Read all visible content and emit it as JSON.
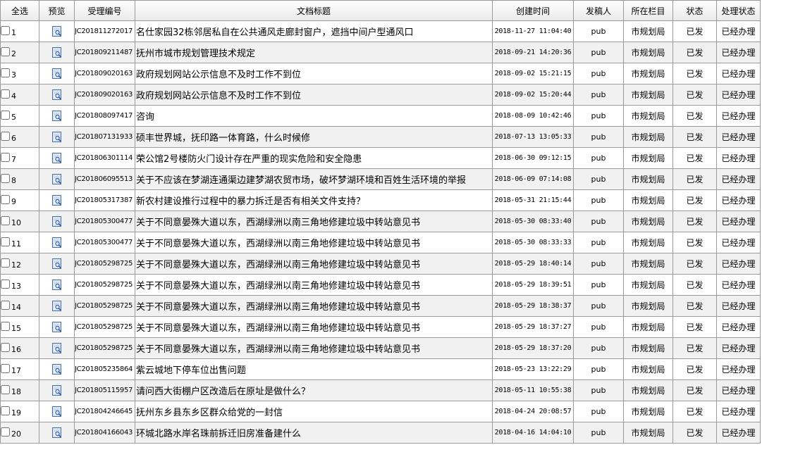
{
  "headers": {
    "select_all": "全选",
    "preview": "预览",
    "number": "受理编号",
    "title": "文档标题",
    "created": "创建时间",
    "sender": "发稿人",
    "column": "所在栏目",
    "status": "状态",
    "process": "处理状态"
  },
  "colors": {
    "border": "#9a9a9a",
    "row_alt": "#f1f1f1"
  },
  "icons": {
    "preview": "document-preview-icon"
  },
  "rows": [
    {
      "idx": "1",
      "no": "JC201811272017",
      "title": "名仕家园32栋邻居私自在公共通风走廊封窗户，遮挡中间户型通风口",
      "time": "2018-11-27 11:04:40",
      "sender": "pub",
      "column": "市规划局",
      "status": "已发",
      "process": "已经办理"
    },
    {
      "idx": "2",
      "no": "JC201809211487",
      "title": "抚州市城市规划管理技术规定",
      "time": "2018-09-21 14:20:36",
      "sender": "pub",
      "column": "市规划局",
      "status": "已发",
      "process": "已经办理"
    },
    {
      "idx": "3",
      "no": "JC201809020163",
      "title": "政府规划网站公示信息不及时工作不到位",
      "time": "2018-09-02 15:21:15",
      "sender": "pub",
      "column": "市规划局",
      "status": "已发",
      "process": "已经办理"
    },
    {
      "idx": "4",
      "no": "JC201809020163",
      "title": "政府规划网站公示信息不及时工作不到位",
      "time": "2018-09-02 15:20:44",
      "sender": "pub",
      "column": "市规划局",
      "status": "已发",
      "process": "已经办理"
    },
    {
      "idx": "5",
      "no": "JC201808097417",
      "title": "咨询",
      "time": "2018-08-09 10:42:46",
      "sender": "pub",
      "column": "市规划局",
      "status": "已发",
      "process": "已经办理"
    },
    {
      "idx": "6",
      "no": "JC201807131933",
      "title": "硕丰世界城，抚印路一体育路，什么时候修",
      "time": "2018-07-13 13:05:33",
      "sender": "pub",
      "column": "市规划局",
      "status": "已发",
      "process": "已经办理"
    },
    {
      "idx": "7",
      "no": "JC201806301114",
      "title": "荣公馆2号楼防火门设计存在严重的现实危险和安全隐患",
      "time": "2018-06-30 09:12:15",
      "sender": "pub",
      "column": "市规划局",
      "status": "已发",
      "process": "已经办理"
    },
    {
      "idx": "8",
      "no": "JC201806095513",
      "title": "关于不应该在梦湖连通渠边建梦湖农贸市场，破坏梦湖环境和百姓生活环境的举报",
      "time": "2018-06-09 07:14:08",
      "sender": "pub",
      "column": "市规划局",
      "status": "已发",
      "process": "已经办理"
    },
    {
      "idx": "9",
      "no": "JC201805317387",
      "title": "新农村建设推行过程中的暴力拆迁是否有相关文件支持？",
      "time": "2018-05-31 21:15:44",
      "sender": "pub",
      "column": "市规划局",
      "status": "已发",
      "process": "已经办理"
    },
    {
      "idx": "10",
      "no": "JC201805300477",
      "title": "关于不同意晏殊大道以东，西湖绿洲以南三角地修建垃圾中转站意见书",
      "time": "2018-05-30 08:33:40",
      "sender": "pub",
      "column": "市规划局",
      "status": "已发",
      "process": "已经办理"
    },
    {
      "idx": "11",
      "no": "JC201805300477",
      "title": "关于不同意晏殊大道以东，西湖绿洲以南三角地修建垃圾中转站意见书",
      "time": "2018-05-30 08:33:33",
      "sender": "pub",
      "column": "市规划局",
      "status": "已发",
      "process": "已经办理"
    },
    {
      "idx": "12",
      "no": "JC201805298725",
      "title": "关于不同意晏殊大道以东，西湖绿洲以南三角地修建垃圾中转站意见书",
      "time": "2018-05-29 18:40:14",
      "sender": "pub",
      "column": "市规划局",
      "status": "已发",
      "process": "已经办理"
    },
    {
      "idx": "13",
      "no": "JC201805298725",
      "title": "关于不同意晏殊大道以东，西湖绿洲以南三角地修建垃圾中转站意见书",
      "time": "2018-05-29 18:39:51",
      "sender": "pub",
      "column": "市规划局",
      "status": "已发",
      "process": "已经办理"
    },
    {
      "idx": "14",
      "no": "JC201805298725",
      "title": "关于不同意晏殊大道以东，西湖绿洲以南三角地修建垃圾中转站意见书",
      "time": "2018-05-29 18:38:37",
      "sender": "pub",
      "column": "市规划局",
      "status": "已发",
      "process": "已经办理"
    },
    {
      "idx": "15",
      "no": "JC201805298725",
      "title": "关于不同意晏殊大道以东，西湖绿洲以南三角地修建垃圾中转站意见书",
      "time": "2018-05-29 18:37:27",
      "sender": "pub",
      "column": "市规划局",
      "status": "已发",
      "process": "已经办理"
    },
    {
      "idx": "16",
      "no": "JC201805298725",
      "title": "关于不同意晏殊大道以东，西湖绿洲以南三角地修建垃圾中转站意见书",
      "time": "2018-05-29 18:37:20",
      "sender": "pub",
      "column": "市规划局",
      "status": "已发",
      "process": "已经办理"
    },
    {
      "idx": "17",
      "no": "JC201805235864",
      "title": "紫云城地下停车位出售问题",
      "time": "2018-05-23 13:22:29",
      "sender": "pub",
      "column": "市规划局",
      "status": "已发",
      "process": "已经办理"
    },
    {
      "idx": "18",
      "no": "JC201805115957",
      "title": "请问西大街棚户区改造后在原址是做什么？",
      "time": "2018-05-11 10:55:38",
      "sender": "pub",
      "column": "市规划局",
      "status": "已发",
      "process": "已经办理"
    },
    {
      "idx": "19",
      "no": "JC201804246645",
      "title": "抚州东乡县东乡区群众给党的一封信",
      "time": "2018-04-24 20:08:57",
      "sender": "pub",
      "column": "市规划局",
      "status": "已发",
      "process": "已经办理"
    },
    {
      "idx": "20",
      "no": "JC201804166043",
      "title": "环城北路水岸名珠前拆迁旧房准备建什么",
      "time": "2018-04-16 14:04:10",
      "sender": "pub",
      "column": "市规划局",
      "status": "已发",
      "process": "已经办理"
    }
  ]
}
